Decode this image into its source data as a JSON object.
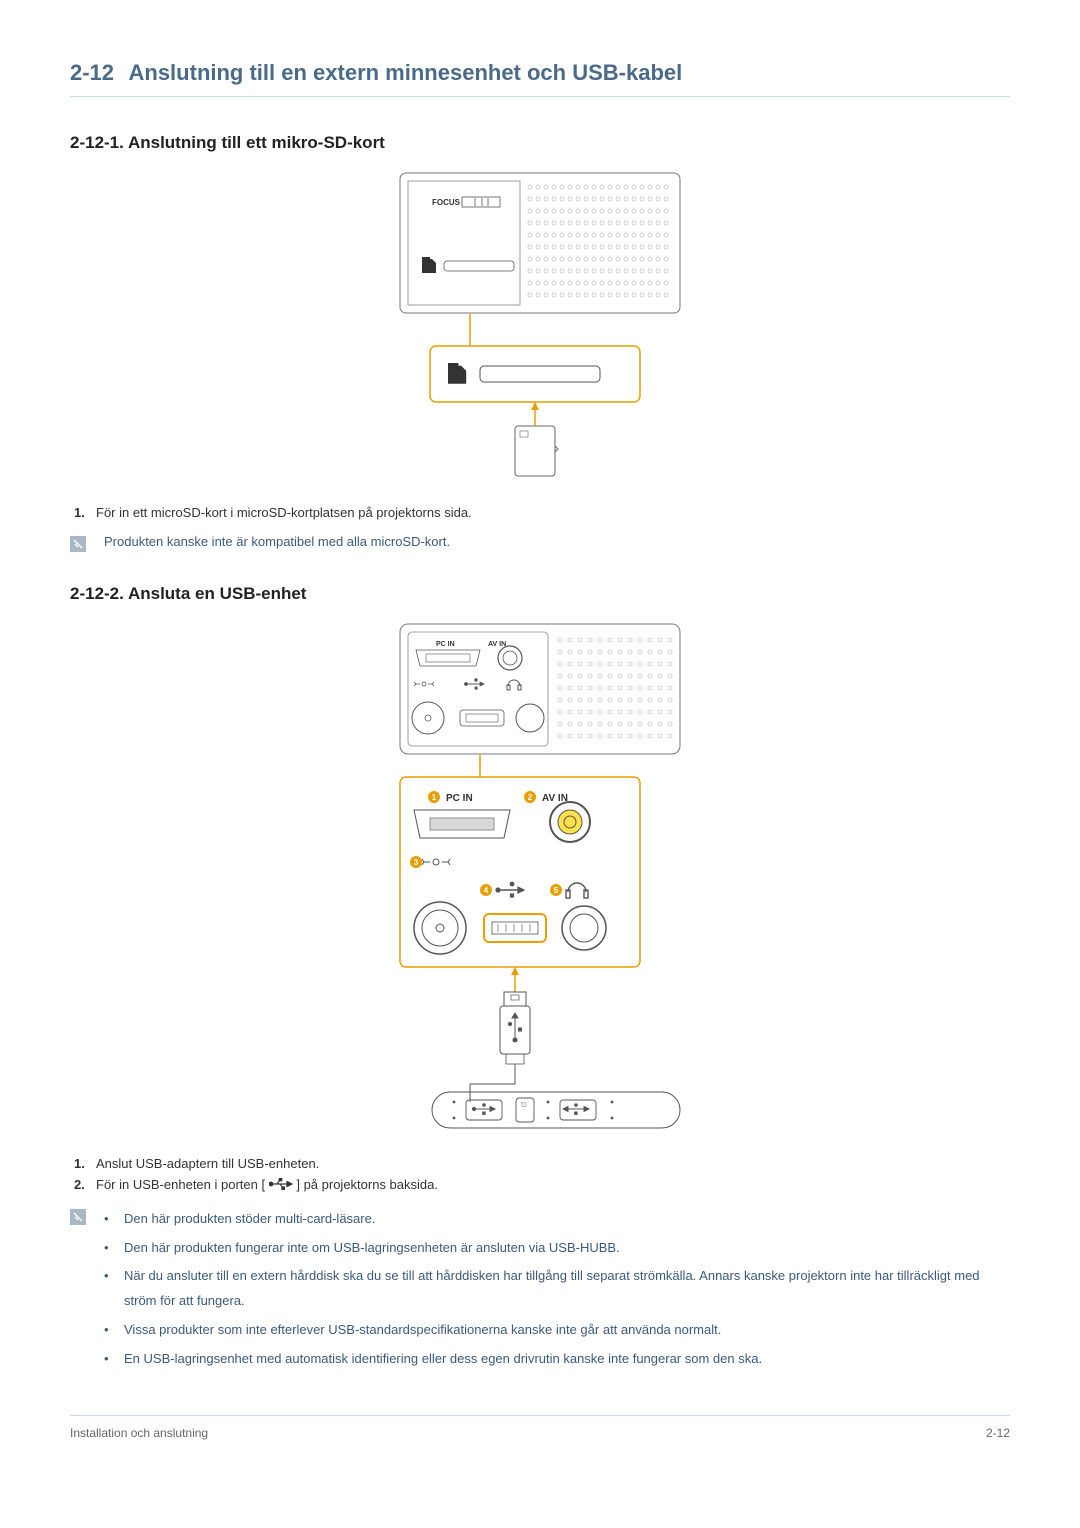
{
  "section": {
    "number": "2-12",
    "title": "Anslutning till en extern minnesenhet och USB-kabel"
  },
  "sub1": {
    "heading": "2-12-1. Anslutning till ett mikro-SD-kort",
    "step1_num": "1.",
    "step1_text": "För in ett microSD-kort i microSD-kortplatsen på projektorns sida.",
    "note": "Produkten kanske inte är kompatibel med alla microSD-kort.",
    "fig": {
      "focus_label": "FOCUS"
    }
  },
  "sub2": {
    "heading": "2-12-2. Ansluta en USB-enhet",
    "step1_num": "1.",
    "step1_text": "Anslut USB-adaptern till USB-enheten.",
    "step2_num": "2.",
    "step2_text_a": "För in USB-enheten i porten [",
    "step2_text_b": "] på projektorns baksida.",
    "fig": {
      "pc_in": "PC IN",
      "av_in": "AV IN"
    },
    "notes": [
      "Den här produkten stöder multi-card-läsare.",
      "Den här produkten fungerar inte om USB-lagringsenheten är ansluten via USB-HUBB.",
      "När du ansluter till en extern hårddisk ska du se till att hårddisken har tillgång till separat strömkälla. Annars kanske projektorn inte har tillräckligt med ström för att fungera.",
      "Vissa produkter som inte efterlever USB-standardspecifikationerna kanske inte går att använda normalt.",
      "En USB-lagringsenhet med automatisk identifiering eller dess egen drivrutin kanske inte fungerar som den ska."
    ]
  },
  "footer": {
    "left": "Installation och anslutning",
    "right": "2-12"
  }
}
